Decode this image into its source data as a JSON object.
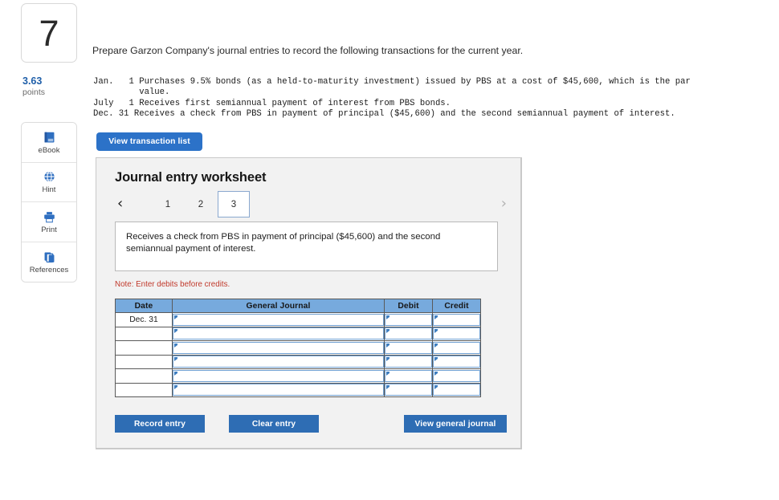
{
  "question": {
    "number": "7",
    "points_value": "3.63",
    "points_label": "points"
  },
  "tools": [
    {
      "label": "eBook",
      "icon": "book-icon"
    },
    {
      "label": "Hint",
      "icon": "globe-icon"
    },
    {
      "label": "Print",
      "icon": "printer-icon"
    },
    {
      "label": "References",
      "icon": "copy-pages-icon"
    }
  ],
  "prompt": "Prepare Garzon Company's journal entries to record the following transactions for the current year.",
  "transactions_text": "Jan.   1 Purchases 9.5% bonds (as a held-to-maturity investment) issued by PBS at a cost of $45,600, which is the par\n         value.\nJuly   1 Receives first semiannual payment of interest from PBS bonds.\nDec. 31 Receives a check from PBS in payment of principal ($45,600) and the second semiannual payment of interest.",
  "view_transaction_list_button": "View transaction list",
  "worksheet": {
    "title": "Journal entry worksheet",
    "prev_chevron": "‹",
    "next_chevron": "›",
    "tabs": [
      "1",
      "2",
      "3"
    ],
    "selected_tab": "3",
    "description": "Receives a check from PBS in payment of principal ($45,600) and the second semiannual payment of interest.",
    "note": "Note: Enter debits before credits.",
    "table": {
      "headers": [
        "Date",
        "General Journal",
        "Debit",
        "Credit"
      ],
      "rows": [
        {
          "date": "Dec. 31",
          "general_journal": "",
          "debit": "",
          "credit": ""
        },
        {
          "date": "",
          "general_journal": "",
          "debit": "",
          "credit": ""
        },
        {
          "date": "",
          "general_journal": "",
          "debit": "",
          "credit": ""
        },
        {
          "date": "",
          "general_journal": "",
          "debit": "",
          "credit": ""
        },
        {
          "date": "",
          "general_journal": "",
          "debit": "",
          "credit": ""
        },
        {
          "date": "",
          "general_journal": "",
          "debit": "",
          "credit": ""
        }
      ]
    },
    "buttons": {
      "record": "Record entry",
      "clear": "Clear entry",
      "view_general_journal": "View general journal"
    }
  },
  "colors": {
    "primary_button": "#2e6db4",
    "link_blue": "#1f5fa9",
    "table_header": "#77aadd",
    "note_red": "#c0392b",
    "panel_bg": "#f2f2f2"
  }
}
